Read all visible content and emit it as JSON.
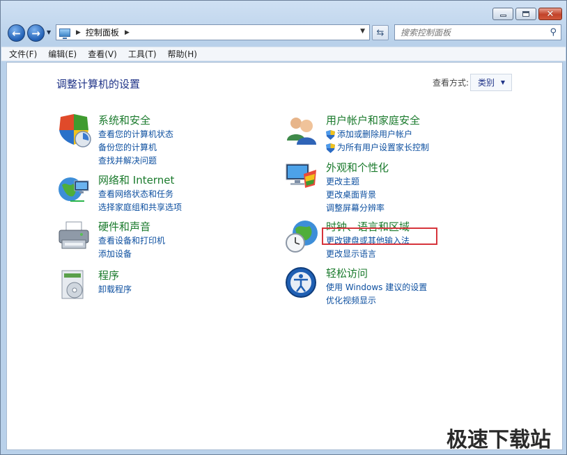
{
  "titlebar": {
    "min_glyph": "",
    "max_glyph": "",
    "close_glyph": "✕"
  },
  "nav": {
    "back_glyph": "←",
    "forward_glyph": "→",
    "dropdown_glyph": "▼"
  },
  "address": {
    "crumb": "控制面板",
    "separator": "▶",
    "arrow": "▶",
    "dropdown": "▼"
  },
  "refresh_glyph": "⇆",
  "search": {
    "placeholder": "搜索控制面板",
    "icon": "search-icon"
  },
  "menu": [
    "文件(F)",
    "编辑(E)",
    "查看(V)",
    "工具(T)",
    "帮助(H)"
  ],
  "main": {
    "title": "调整计算机的设置",
    "view_by_label": "查看方式:",
    "view_by_value": "类别",
    "view_by_arrow": "▼"
  },
  "categories": [
    {
      "title": "系统和安全",
      "links": [
        "查看您的计算机状态",
        "备份您的计算机",
        "查找并解决问题"
      ]
    },
    {
      "title": "网络和 Internet",
      "links": [
        "查看网络状态和任务",
        "选择家庭组和共享选项"
      ]
    },
    {
      "title": "硬件和声音",
      "links": [
        "查看设备和打印机",
        "添加设备"
      ]
    },
    {
      "title": "程序",
      "links": [
        "卸载程序"
      ]
    },
    {
      "title": "用户帐户和家庭安全",
      "links": [
        "添加或删除用户帐户",
        "为所有用户设置家长控制"
      ]
    },
    {
      "title": "外观和个性化",
      "links": [
        "更改主题",
        "更改桌面背景",
        "调整屏幕分辨率"
      ]
    },
    {
      "title": "时钟、语言和区域",
      "links": [
        "更改键盘或其他输入法",
        "更改显示语言"
      ]
    },
    {
      "title": "轻松访问",
      "links": [
        "使用 Windows 建议的设置",
        "优化视频显示"
      ]
    }
  ],
  "colors": {
    "category_title": "#1a7a2c",
    "link": "#0e50a0",
    "page_title": "#1e3287",
    "highlight": "#d6343b"
  },
  "watermark": "极速下载站"
}
